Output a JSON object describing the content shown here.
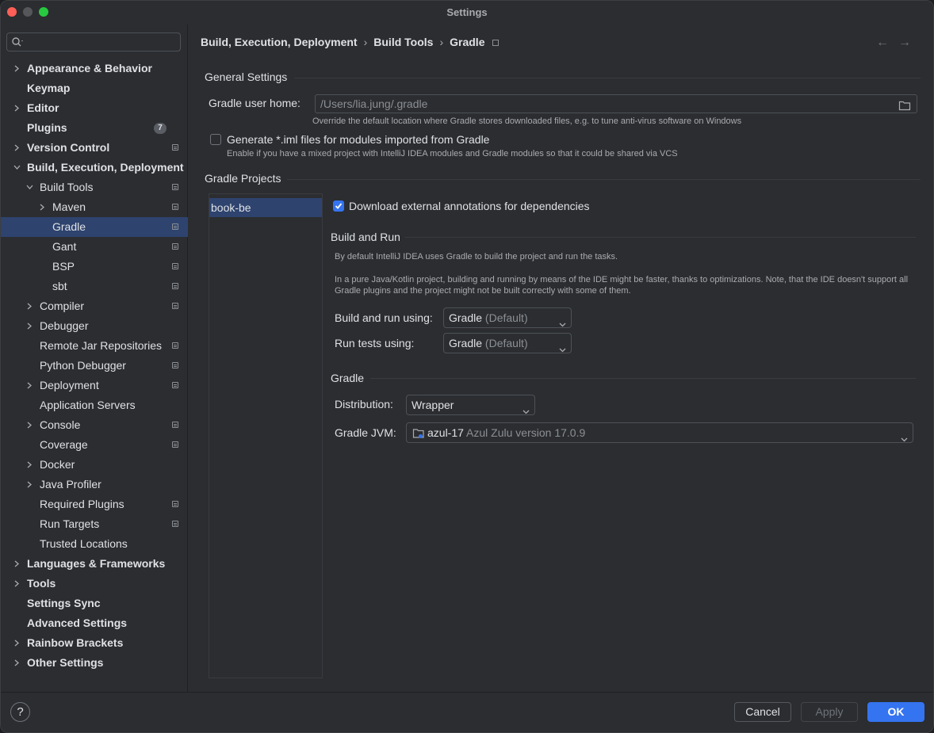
{
  "window": {
    "title": "Settings"
  },
  "search": {
    "placeholder": ""
  },
  "sidebar": {
    "items": [
      {
        "label": "Appearance & Behavior"
      },
      {
        "label": "Keymap"
      },
      {
        "label": "Editor"
      },
      {
        "label": "Plugins",
        "badge": "7"
      },
      {
        "label": "Version Control"
      },
      {
        "label": "Build, Execution, Deployment"
      },
      {
        "label": "Build Tools"
      },
      {
        "label": "Maven"
      },
      {
        "label": "Gradle"
      },
      {
        "label": "Gant"
      },
      {
        "label": "BSP"
      },
      {
        "label": "sbt"
      },
      {
        "label": "Compiler"
      },
      {
        "label": "Debugger"
      },
      {
        "label": "Remote Jar Repositories"
      },
      {
        "label": "Python Debugger"
      },
      {
        "label": "Deployment"
      },
      {
        "label": "Application Servers"
      },
      {
        "label": "Console"
      },
      {
        "label": "Coverage"
      },
      {
        "label": "Docker"
      },
      {
        "label": "Java Profiler"
      },
      {
        "label": "Required Plugins"
      },
      {
        "label": "Run Targets"
      },
      {
        "label": "Trusted Locations"
      },
      {
        "label": "Languages & Frameworks"
      },
      {
        "label": "Tools"
      },
      {
        "label": "Settings Sync"
      },
      {
        "label": "Advanced Settings"
      },
      {
        "label": "Rainbow Brackets"
      },
      {
        "label": "Other Settings"
      }
    ]
  },
  "breadcrumb": {
    "items": [
      "Build, Execution, Deployment",
      "Build Tools",
      "Gradle"
    ],
    "separator": "›"
  },
  "general": {
    "title": "General Settings",
    "user_home_label": "Gradle user home:",
    "user_home_value": "/Users/lia.jung/.gradle",
    "user_home_hint": "Override the default location where Gradle stores downloaded files, e.g. to tune anti-virus software on Windows",
    "generate_iml_label": "Generate *.iml files for modules imported from Gradle",
    "generate_iml_hint": "Enable if you have a mixed project with IntelliJ IDEA modules and Gradle modules so that it could be shared via VCS",
    "generate_iml_checked": false
  },
  "projects": {
    "title": "Gradle Projects",
    "list": [
      "book-be"
    ],
    "download_annotations_label": "Download external annotations for dependencies",
    "download_annotations_checked": true,
    "build_run": {
      "title": "Build and Run",
      "hint1": "By default IntelliJ IDEA uses Gradle to build the project and run the tasks.",
      "hint2": "In a pure Java/Kotlin project, building and running by means of the IDE might be faster, thanks to optimizations. Note, that the IDE doesn't support all Gradle plugins and the project might not be built correctly with some of them.",
      "build_label": "Build and run using:",
      "build_value": "Gradle",
      "build_suffix": "(Default)",
      "tests_label": "Run tests using:",
      "tests_value": "Gradle",
      "tests_suffix": "(Default)"
    },
    "gradle": {
      "title": "Gradle",
      "distribution_label": "Distribution:",
      "distribution_value": "Wrapper",
      "jvm_label": "Gradle JVM:",
      "jvm_value": "azul-17",
      "jvm_detail": "Azul Zulu version 17.0.9"
    }
  },
  "footer": {
    "help": "?",
    "cancel": "Cancel",
    "apply": "Apply",
    "ok": "OK"
  },
  "colors": {
    "accent": "#3574f0",
    "selection": "#2e436e",
    "background": "#2b2d30"
  }
}
